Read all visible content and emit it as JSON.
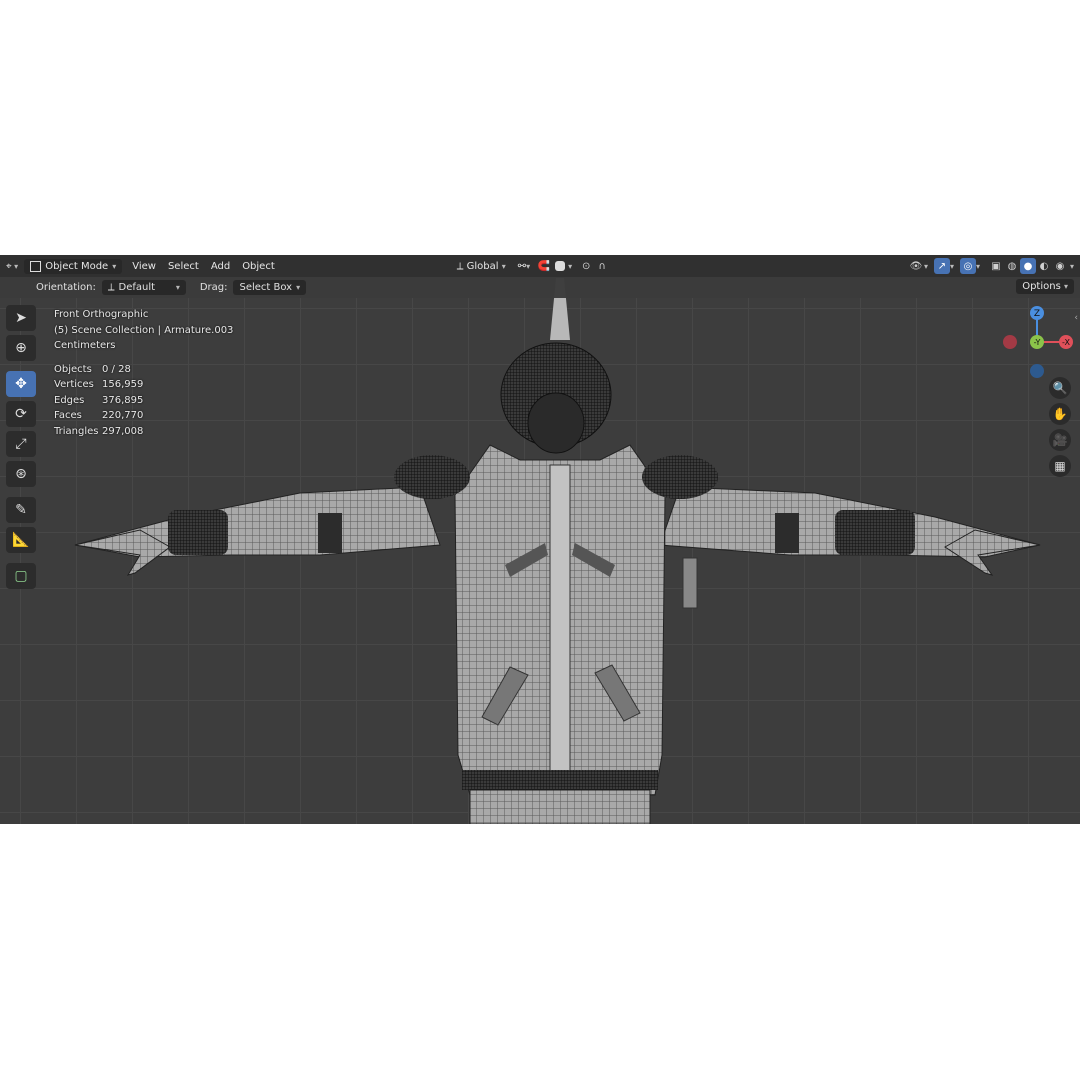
{
  "header": {
    "editor_type_icon": "viewport-icon",
    "mode": "Object Mode",
    "menus": [
      "View",
      "Select",
      "Add",
      "Object"
    ],
    "transform_space": "Global",
    "options_label": "Options"
  },
  "toolrow": {
    "orientation_label": "Orientation:",
    "orientation_value": "Default",
    "drag_label": "Drag:",
    "drag_value": "Select Box"
  },
  "overlay": {
    "view_name": "Front Orthographic",
    "collection": "(5) Scene Collection | Armature.003",
    "units": "Centimeters",
    "stats": [
      {
        "label": "Objects",
        "value": "0 / 28"
      },
      {
        "label": "Vertices",
        "value": "156,959"
      },
      {
        "label": "Edges",
        "value": "376,895"
      },
      {
        "label": "Faces",
        "value": "220,770"
      },
      {
        "label": "Triangles",
        "value": "297,008"
      }
    ]
  },
  "gizmo": {
    "z": "Z",
    "y": "-Y",
    "x": "-X"
  },
  "tools": [
    "select-box-tool",
    "cursor-tool",
    "move-tool",
    "rotate-tool",
    "scale-tool",
    "transform-tool",
    "annotate-tool",
    "measure-tool",
    "add-cube-tool"
  ],
  "colors": {
    "active": "#4772b3",
    "x_axis": "#e0505a",
    "y_axis": "#8bc34a",
    "z_axis": "#4a8fe0"
  }
}
